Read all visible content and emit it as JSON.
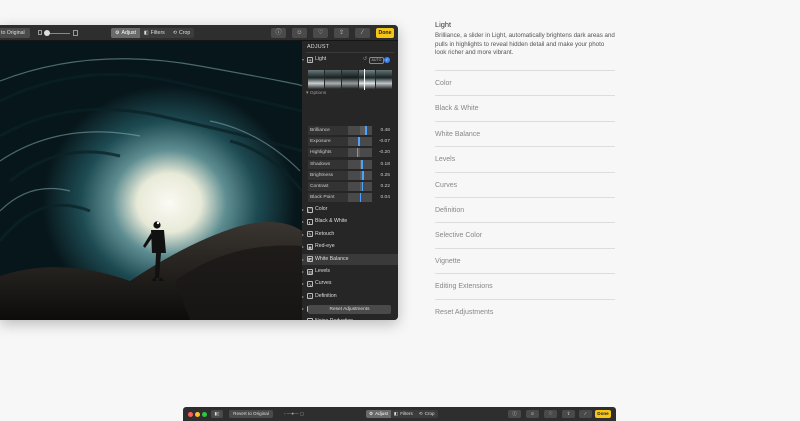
{
  "toolbar": {
    "revert_label": "to Original",
    "tabs": [
      {
        "label": "Adjust",
        "icon": "adjust-icon",
        "active": true
      },
      {
        "label": "Filters",
        "icon": "filters-icon",
        "active": false
      },
      {
        "label": "Crop",
        "icon": "crop-icon",
        "active": false
      }
    ],
    "icons": [
      "info-icon",
      "emoji-icon",
      "heart-icon",
      "share-icon",
      "magic-wand-icon"
    ],
    "done_label": "Done"
  },
  "panel": {
    "title": "ADJUST",
    "light": {
      "label": "Light",
      "auto_label": "AUTO",
      "options_label": "Options",
      "options": [
        {
          "label": "Brilliance",
          "value": "0.48",
          "level": 0.48
        },
        {
          "label": "Exposure",
          "value": "-0.07",
          "level": -0.07
        },
        {
          "label": "Highlights",
          "value": "-0.20",
          "level": -0.2
        },
        {
          "label": "Shadows",
          "value": "0.18",
          "level": 0.18
        },
        {
          "label": "Brightness",
          "value": "0.25",
          "level": 0.25
        },
        {
          "label": "Contrast",
          "value": "0.22",
          "level": 0.22
        },
        {
          "label": "Black Point",
          "value": "0.04",
          "level": 0.04
        }
      ]
    },
    "sections": [
      {
        "label": "Color",
        "icon": "color-icon"
      },
      {
        "label": "Black & White",
        "icon": "black-white-icon"
      },
      {
        "label": "Retouch",
        "icon": "retouch-icon"
      },
      {
        "label": "Red-eye",
        "icon": "red-eye-icon"
      },
      {
        "label": "White Balance",
        "icon": "white-balance-icon"
      },
      {
        "label": "Levels",
        "icon": "levels-icon"
      },
      {
        "label": "Curves",
        "icon": "curves-icon"
      },
      {
        "label": "Definition",
        "icon": "definition-icon"
      },
      {
        "label": "Selective Color",
        "icon": "selective-color-icon"
      },
      {
        "label": "Noise Reduction",
        "icon": "noise-reduction-icon"
      }
    ],
    "reset_label": "Reset Adjustments"
  },
  "help": {
    "title": "Light",
    "description": "Brilliance, a slider in Light, automatically brightens dark areas and pulls in highlights to reveal hidden detail and make your photo look richer and more vibrant.",
    "items": [
      "Color",
      "Black & White",
      "White Balance",
      "Levels",
      "Curves",
      "Definition",
      "Selective Color",
      "Vignette",
      "Editing Extensions",
      "Reset Adjustments"
    ]
  },
  "bottom_toolbar": {
    "revert_label": "Revert to Original",
    "tabs": [
      "Adjust",
      "Filters",
      "Crop"
    ],
    "done_label": "Done"
  },
  "colors": {
    "accent_done": "#f5c518",
    "accent_blue": "#3a82f7",
    "window_bg": "#1e1e1e"
  }
}
